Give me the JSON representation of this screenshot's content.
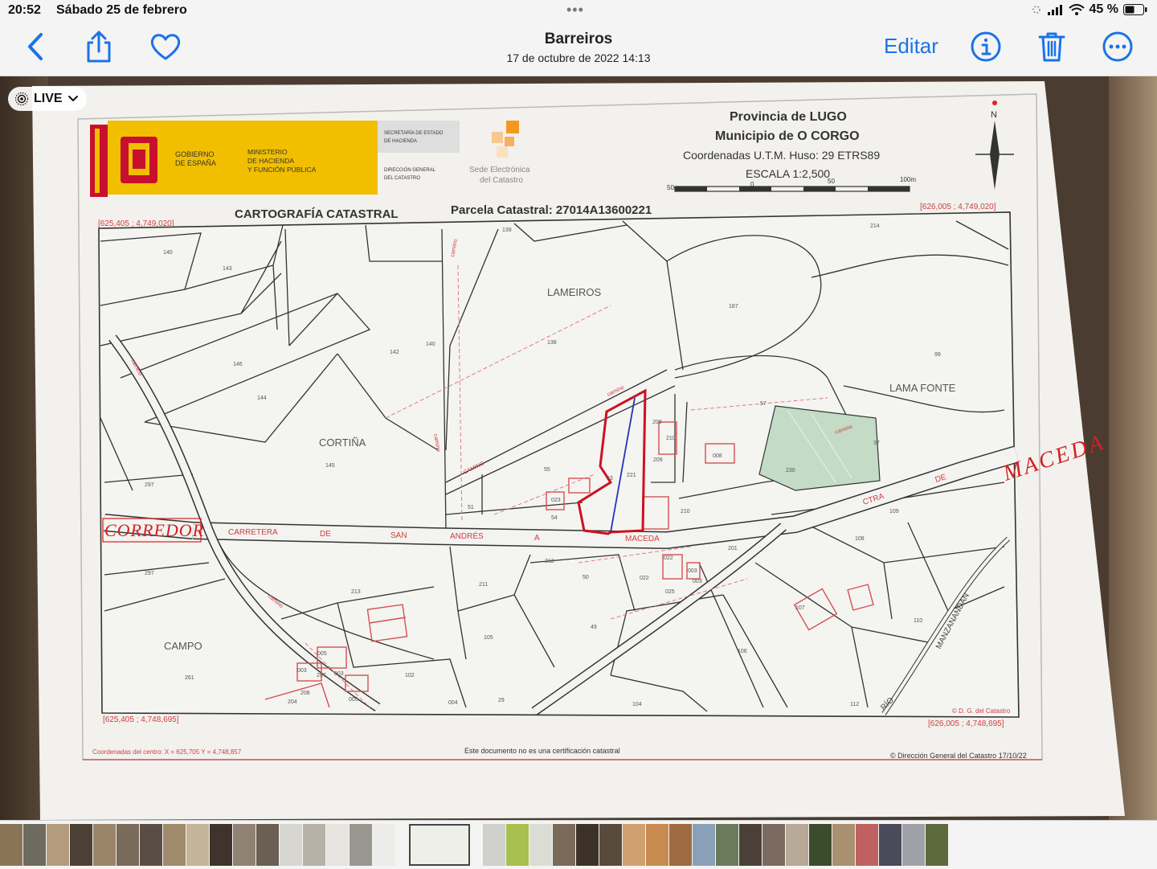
{
  "status_bar": {
    "time": "20:52",
    "date": "Sábado 25 de febrero",
    "dots": "•••",
    "battery": "45 %"
  },
  "nav": {
    "title": "Barreiros",
    "subtitle": "17 de octubre de 2022  14:13",
    "edit_label": "Editar",
    "icons": [
      "back-chevron-icon",
      "share-icon",
      "heart-icon",
      "info-icon",
      "trash-icon",
      "more-icon"
    ],
    "accent_color": "#1a73e8"
  },
  "live_badge": {
    "label": "LIVE"
  },
  "document": {
    "gov_line1": "GOBIERNO",
    "gov_line2": "DE ESPAÑA",
    "ministry_line1": "MINISTERIO",
    "ministry_line2": "DE HACIENDA",
    "ministry_line3": "Y FUNCIÓN PÚBLICA",
    "secretaria_line1": "SECRETARÍA DE ESTADO",
    "secretaria_line2": "DE HACIENDA",
    "direccion_line1": "DIRECCIÓN GENERAL",
    "direccion_line2": "DEL CATASTRO",
    "sede_line1": "Sede Electrónica",
    "sede_line2": "del Catastro",
    "provincia": "Provincia de LUGO",
    "municipio": "Municipio de O CORGO",
    "coordenadas": "Coordenadas U.T.M. Huso: 29 ETRS89",
    "escala": "ESCALA 1:2,500",
    "scale_ticks": [
      "50m",
      "0",
      "50",
      "100m"
    ],
    "north": "N",
    "map_title": "CARTOGRAFÍA CATASTRAL",
    "parcela": "Parcela Catastral: 27014A13600221",
    "coord_tl": "[625,405 ; 4,749,020]",
    "coord_tr": "[626,005 ; 4,749,020]",
    "coord_bl": "[625,405 ; 4,748,695]",
    "coord_br": "[626,005 ; 4,748,695]",
    "footer_left": "Coordenadas del centro: X = 625,705 Y = 4,748,857",
    "footer_center": "Este documento no es una certificación catastral",
    "footer_right": "© Dirección General del Catastro 17/10/22",
    "copyright_small": "© D. G. del Catastro",
    "places": [
      "LAMEIROS",
      "LAMA FONTE",
      "CORTIÑA",
      "CAMPO"
    ],
    "road_words": [
      "CARRETERA",
      "DE",
      "SAN",
      "ANDRÉS",
      "A",
      "MACEDA"
    ],
    "road_east": [
      "CTRA",
      "DE"
    ],
    "river": [
      "MANZANANDAN",
      "RÍO"
    ],
    "handwritten_left": "CORREDOR",
    "handwritten_right": "MACEDA",
    "small_labels": [
      "camino",
      "camino",
      "CAMINO",
      "camino",
      "camino",
      "camino",
      "camino"
    ],
    "parcel_numbers": [
      "139",
      "214",
      "140",
      "143",
      "146",
      "144",
      "142",
      "140",
      "138",
      "187",
      "99",
      "57",
      "208",
      "210",
      "209",
      "008",
      "230",
      "37",
      "55",
      "53",
      "221",
      "023",
      "54",
      "51",
      "297",
      "145",
      "210",
      "109",
      "108",
      "201",
      "212",
      "211",
      "50",
      "022",
      "022",
      "025",
      "003",
      "003",
      "297",
      "213",
      "49",
      "106",
      "107",
      "110",
      "105",
      "102",
      "005",
      "003",
      "297",
      "003",
      "005",
      "208",
      "204",
      "004",
      "29",
      "104",
      "112",
      "261"
    ]
  }
}
